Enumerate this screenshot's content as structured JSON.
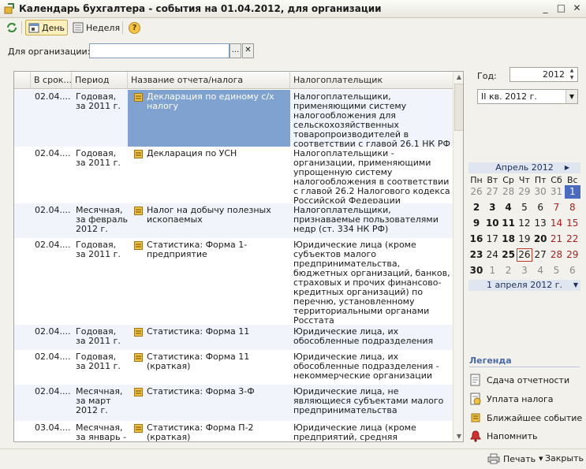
{
  "window": {
    "title": "Календарь бухгалтера - события на 01.04.2012, для организации",
    "controls": [
      "_",
      "□",
      "✕"
    ]
  },
  "toolbar": {
    "day_label": "День",
    "week_label": "Неделя",
    "help_label": "?"
  },
  "filter": {
    "label": "Для организации:",
    "value": "",
    "select_label": "...",
    "clear_label": "✕"
  },
  "table": {
    "columns": [
      "В срок...",
      "Период",
      "Название отчета/налога",
      "Налогоплательщик"
    ],
    "rows": [
      {
        "date": "02.04....",
        "period": "Годовая, за 2011 г.",
        "name": "Декларация по единому с/х налогу",
        "payer": "Налогоплательщики, применяющими систему налогообложения для сельскохозяйственных товаропроизводителей в соответствии с главой 26.1 НК РФ"
      },
      {
        "date": "02.04....",
        "period": "Годовая, за 2011 г.",
        "name": "Декларация по УСН",
        "payer": "Налогоплательщики - организации, применяющими упрощенную систему налогообложения в соответствии с главой 26.2 Налогового кодекса Российской Федерации"
      },
      {
        "date": "02.04....",
        "period": "Месячная, за февраль 2012 г.",
        "name": "Налог на добычу полезных ископаемых",
        "payer": "Налогоплательщики, признаваемые пользователями недр (ст. 334 НК РФ)"
      },
      {
        "date": "02.04....",
        "period": "Годовая, за 2011 г.",
        "name": "Статистика: Форма 1-предприятие",
        "payer": "Юридические лица (кроме субъектов малого предпринимательства, бюджетных организаций, банков, страховых и прочих финансово-кредитных организаций) по перечню, установленному территориальными органами Росстата"
      },
      {
        "date": "02.04....",
        "period": "Годовая, за 2011 г.",
        "name": "Статистика: Форма 11",
        "payer": "Юридические лица, их обособленные подразделения"
      },
      {
        "date": "02.04....",
        "period": "Годовая, за 2011 г.",
        "name": "Статистика: Форма 11 (краткая)",
        "payer": "Юридические лица, их обособленные подразделения - некоммерческие организации"
      },
      {
        "date": "02.04....",
        "period": "Месячная, за март 2012 г.",
        "name": "Статистика: Форма 3-Ф",
        "payer": "Юридические лица, не являющиеся субъектами малого предпринимательства"
      },
      {
        "date": "03.04....",
        "period": "Месячная, за январь -",
        "name": "Статистика: Форма П-2 (краткая)",
        "payer": "Юридические лица (кроме предприятий, средняя численность"
      }
    ]
  },
  "right": {
    "year_label": "Год:",
    "year_value": "2012",
    "quarter_value": "II кв. 2012 г."
  },
  "calendar": {
    "month_title": "Апрель 2012",
    "dow": [
      "Пн",
      "Вт",
      "Ср",
      "Чт",
      "Пт",
      "Сб",
      "Вс"
    ],
    "weeks": [
      [
        {
          "d": "26",
          "c": "other"
        },
        {
          "d": "27",
          "c": "other"
        },
        {
          "d": "28",
          "c": "other"
        },
        {
          "d": "29",
          "c": "other"
        },
        {
          "d": "30",
          "c": "other"
        },
        {
          "d": "31",
          "c": "other"
        },
        {
          "d": "1",
          "c": "selected"
        }
      ],
      [
        {
          "d": "2",
          "c": "bold"
        },
        {
          "d": "3",
          "c": "bold"
        },
        {
          "d": "4",
          "c": "bold"
        },
        {
          "d": "5",
          "c": ""
        },
        {
          "d": "6",
          "c": ""
        },
        {
          "d": "7",
          "c": "weekend"
        },
        {
          "d": "8",
          "c": "weekend"
        }
      ],
      [
        {
          "d": "9",
          "c": "bold"
        },
        {
          "d": "10",
          "c": "bold"
        },
        {
          "d": "11",
          "c": "bold"
        },
        {
          "d": "12",
          "c": ""
        },
        {
          "d": "13",
          "c": ""
        },
        {
          "d": "14",
          "c": "weekend"
        },
        {
          "d": "15",
          "c": "weekend"
        }
      ],
      [
        {
          "d": "16",
          "c": "bold"
        },
        {
          "d": "17",
          "c": ""
        },
        {
          "d": "18",
          "c": "bold"
        },
        {
          "d": "19",
          "c": ""
        },
        {
          "d": "20",
          "c": "bold"
        },
        {
          "d": "21",
          "c": "weekend"
        },
        {
          "d": "22",
          "c": "weekend"
        }
      ],
      [
        {
          "d": "23",
          "c": "bold"
        },
        {
          "d": "24",
          "c": ""
        },
        {
          "d": "25",
          "c": "bold"
        },
        {
          "d": "26",
          "c": "today"
        },
        {
          "d": "27",
          "c": ""
        },
        {
          "d": "28",
          "c": "weekend"
        },
        {
          "d": "29",
          "c": "weekend"
        }
      ],
      [
        {
          "d": "30",
          "c": "bold"
        },
        {
          "d": "1",
          "c": "other"
        },
        {
          "d": "2",
          "c": "other"
        },
        {
          "d": "3",
          "c": "other"
        },
        {
          "d": "4",
          "c": "other"
        },
        {
          "d": "5",
          "c": "other"
        },
        {
          "d": "6",
          "c": "other"
        }
      ]
    ],
    "footer": "1 апреля 2012 г."
  },
  "legend": {
    "title": "Легенда",
    "items": [
      {
        "label": "Сдача отчетности",
        "icon": "report-submit-icon"
      },
      {
        "label": "Уплата налога",
        "icon": "tax-payment-icon"
      },
      {
        "label": "Ближайшее событие",
        "icon": "nearest-event-icon"
      },
      {
        "label": "Напомнить",
        "icon": "reminder-bell-icon"
      }
    ]
  },
  "bottom": {
    "print_label": "Печать",
    "close_label": "Закрыть"
  },
  "colors": {
    "selection": "#7fa2d0",
    "legend_title": "#4a6aa6",
    "weekend": "#b01c1c"
  }
}
